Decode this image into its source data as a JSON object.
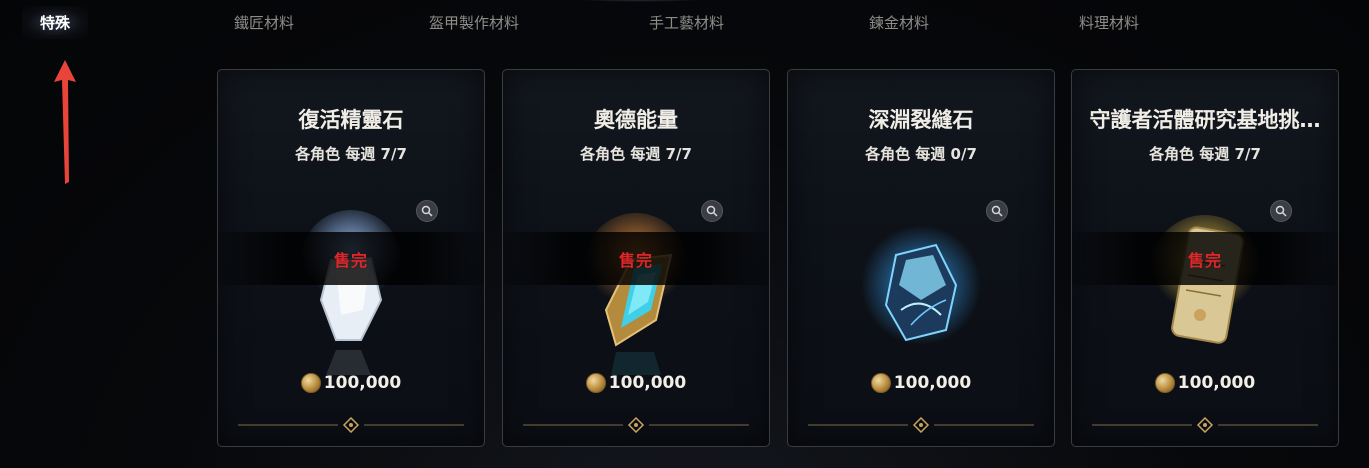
{
  "tabs": [
    {
      "label": "特殊",
      "active": true
    },
    {
      "label": "鐵匠材料",
      "active": false
    },
    {
      "label": "盔甲製作材料",
      "active": false
    },
    {
      "label": "手工藝材料",
      "active": false
    },
    {
      "label": "鍊金材料",
      "active": false
    },
    {
      "label": "料理材料",
      "active": false
    }
  ],
  "cards": [
    {
      "title": "復活精靈石",
      "limit": "各角色 每週 7/7",
      "status": "售完",
      "price": "100,000",
      "art": "white-crystal-icon",
      "glow": "#7fb4ff"
    },
    {
      "title": "奧德能量",
      "limit": "各角色 每週 7/7",
      "status": "售完",
      "price": "100,000",
      "art": "blue-gold-gem-icon",
      "glow": "#ff9a3a"
    },
    {
      "title": "深淵裂縫石",
      "limit": "各角色 每週 0/7",
      "status": "",
      "price": "100,000",
      "art": "abyss-rift-stone-icon",
      "glow": "#3aa8ff"
    },
    {
      "title": "守護者活體研究基地挑…",
      "limit": "各角色 每週 7/7",
      "status": "售完",
      "price": "100,000",
      "art": "golden-scroll-icon",
      "glow": "#ffd34a"
    }
  ],
  "colors": {
    "sold_out": "#e0262a",
    "annotation_arrow": "#e8443a"
  }
}
